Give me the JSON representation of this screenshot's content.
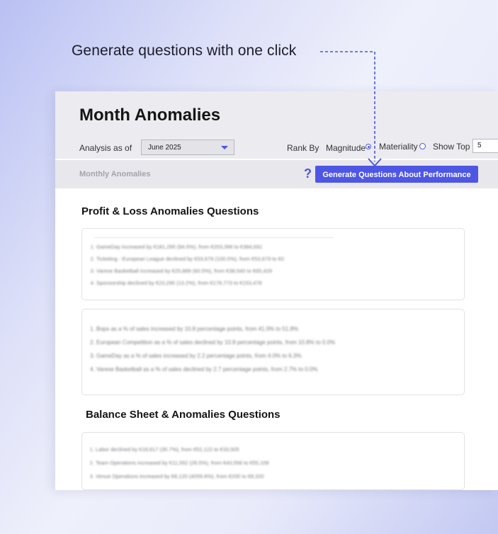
{
  "callout": {
    "text": "Generate questions with one click"
  },
  "header": {
    "title": "Month Anomalies",
    "analysis_label": "Analysis as of",
    "analysis_value": "June 2025",
    "rank_by_label": "Rank By",
    "rank_options": [
      {
        "label": "Magnitude",
        "selected": true
      },
      {
        "label": "Materiality",
        "selected": false
      }
    ],
    "show_top_label": "Show Top",
    "show_top_value": "5"
  },
  "subbar": {
    "label": "Monthly Anomalies",
    "help_icon": "?",
    "button_label": "Generate Questions About Performance"
  },
  "sections": [
    {
      "title": "Profit & Loss Anomalies Questions",
      "cards": [
        {
          "items": [
            "GameDay increased by €181,295 (94.5%), from €203,396 to €384,691",
            "Ticketing - European League declined by €53,679 (100.0%), from €53,679 to €0",
            "Varese Basketball increased by €25,889 (60.5%), from €38,540 to €65,429",
            "Sponsorship declined by €23,295 (13.2%), from €176,773 to €153,478"
          ]
        },
        {
          "items": [
            "Bops as a % of sales increased by 10.8 percentage points, from 41.0% to 51.8%",
            "European Competition as a % of sales declined by 10.8 percentage points, from 10.8% to 0.0%",
            "GameDay as a % of sales increased by 2.2 percentage points, from 4.0% to 6.3%",
            "Varese Basketball as a % of sales declined by 2.7 percentage points, from 2.7% to 0.0%"
          ]
        }
      ]
    },
    {
      "title": "Balance Sheet & Anomalies Questions",
      "cards": [
        {
          "items": [
            "Labor declined by €18,617 (35.7%), from €52,122 to €33,505",
            "Team Operations increased by €11,552 (26.5%), from €43,556 to €55,108",
            "Venue Operations increased by €8,120 (4059.8%), from €200 to €8,320"
          ]
        }
      ]
    }
  ],
  "colors": {
    "accent": "#4e56e4",
    "header_bg": "#ecebf0"
  }
}
